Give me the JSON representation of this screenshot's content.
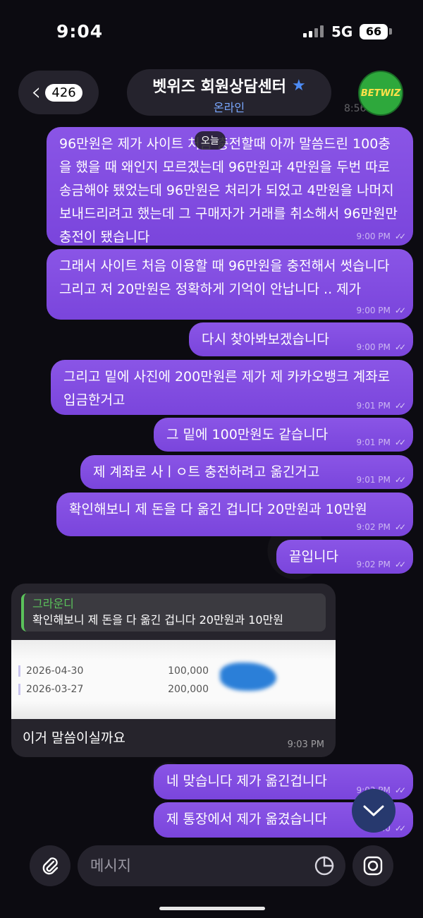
{
  "status_bar": {
    "time": "9:04",
    "network": "5G",
    "battery": "66"
  },
  "header": {
    "back_count": "426",
    "title": "벳위즈 회원상담센터",
    "status": "온라인",
    "avatar_text": "BETWIZ",
    "ghost_time": "8:56"
  },
  "date_badge": "오늘",
  "messages": [
    {
      "text": "96만원은 제가 사이트 처음 충전할때 아까 말씀드린 100충을 했을 때 왜인지 모르겠는데 96만원과 4만원을 두번 따로 송금해야 됐었는데 96만원은 처리가 되었고 4만원을 나머지 보내드리려고 했는데 그 구매자가 거래를 취소해서 96만원만 충전이 됐습니다",
      "time": "9:00 PM"
    },
    {
      "text": "그래서 사이트 처음 이용할 때 96만원을 충전해서 썻습니다 그리고 저 20만원은 정확하게 기억이 안납니다 .. 제가",
      "time": "9:00 PM"
    },
    {
      "text": "다시 찾아봐보겠습니다",
      "time": "9:00 PM"
    },
    {
      "text": "그리고 밑에 사진에 200만원른 제가 제 카카오뱅크 계좌로 입금한거고",
      "time": "9:01 PM"
    },
    {
      "text": "그 밑에 100만원도 같습니다",
      "time": "9:01 PM"
    },
    {
      "text": "제 계좌로 사ㅣㅇ트 충전하려고 옮긴거고",
      "time": "9:01 PM"
    },
    {
      "text": "확인해보니 제 돈을 다 옮긴 겁니다 20만원과 10만원",
      "time": "9:02 PM"
    },
    {
      "text": "끝입니다",
      "time": "9:02 PM"
    }
  ],
  "incoming": {
    "reply_author": "그라운디",
    "reply_text": "확인해보니 제 돈을 다 옮긴 겁니다 20만원과 10만원",
    "photo_rows": [
      {
        "date": "2026-04-30",
        "amount": "100,000"
      },
      {
        "date": "2026-03-27",
        "amount": "200,000"
      }
    ],
    "text": "이거 말씀이실까요",
    "time": "9:03 PM"
  },
  "replies": [
    {
      "text": "네 맞습니다 제가 옮긴겁니다",
      "time": "9:03 PM"
    },
    {
      "text": "제 통장에서 제가 옮겼습니다",
      "time": "9:0"
    }
  ],
  "input": {
    "placeholder": "메시지"
  },
  "colors": {
    "outgoing": "#8a55e6",
    "incoming": "#26242c",
    "accent": "#4d8cf5"
  }
}
